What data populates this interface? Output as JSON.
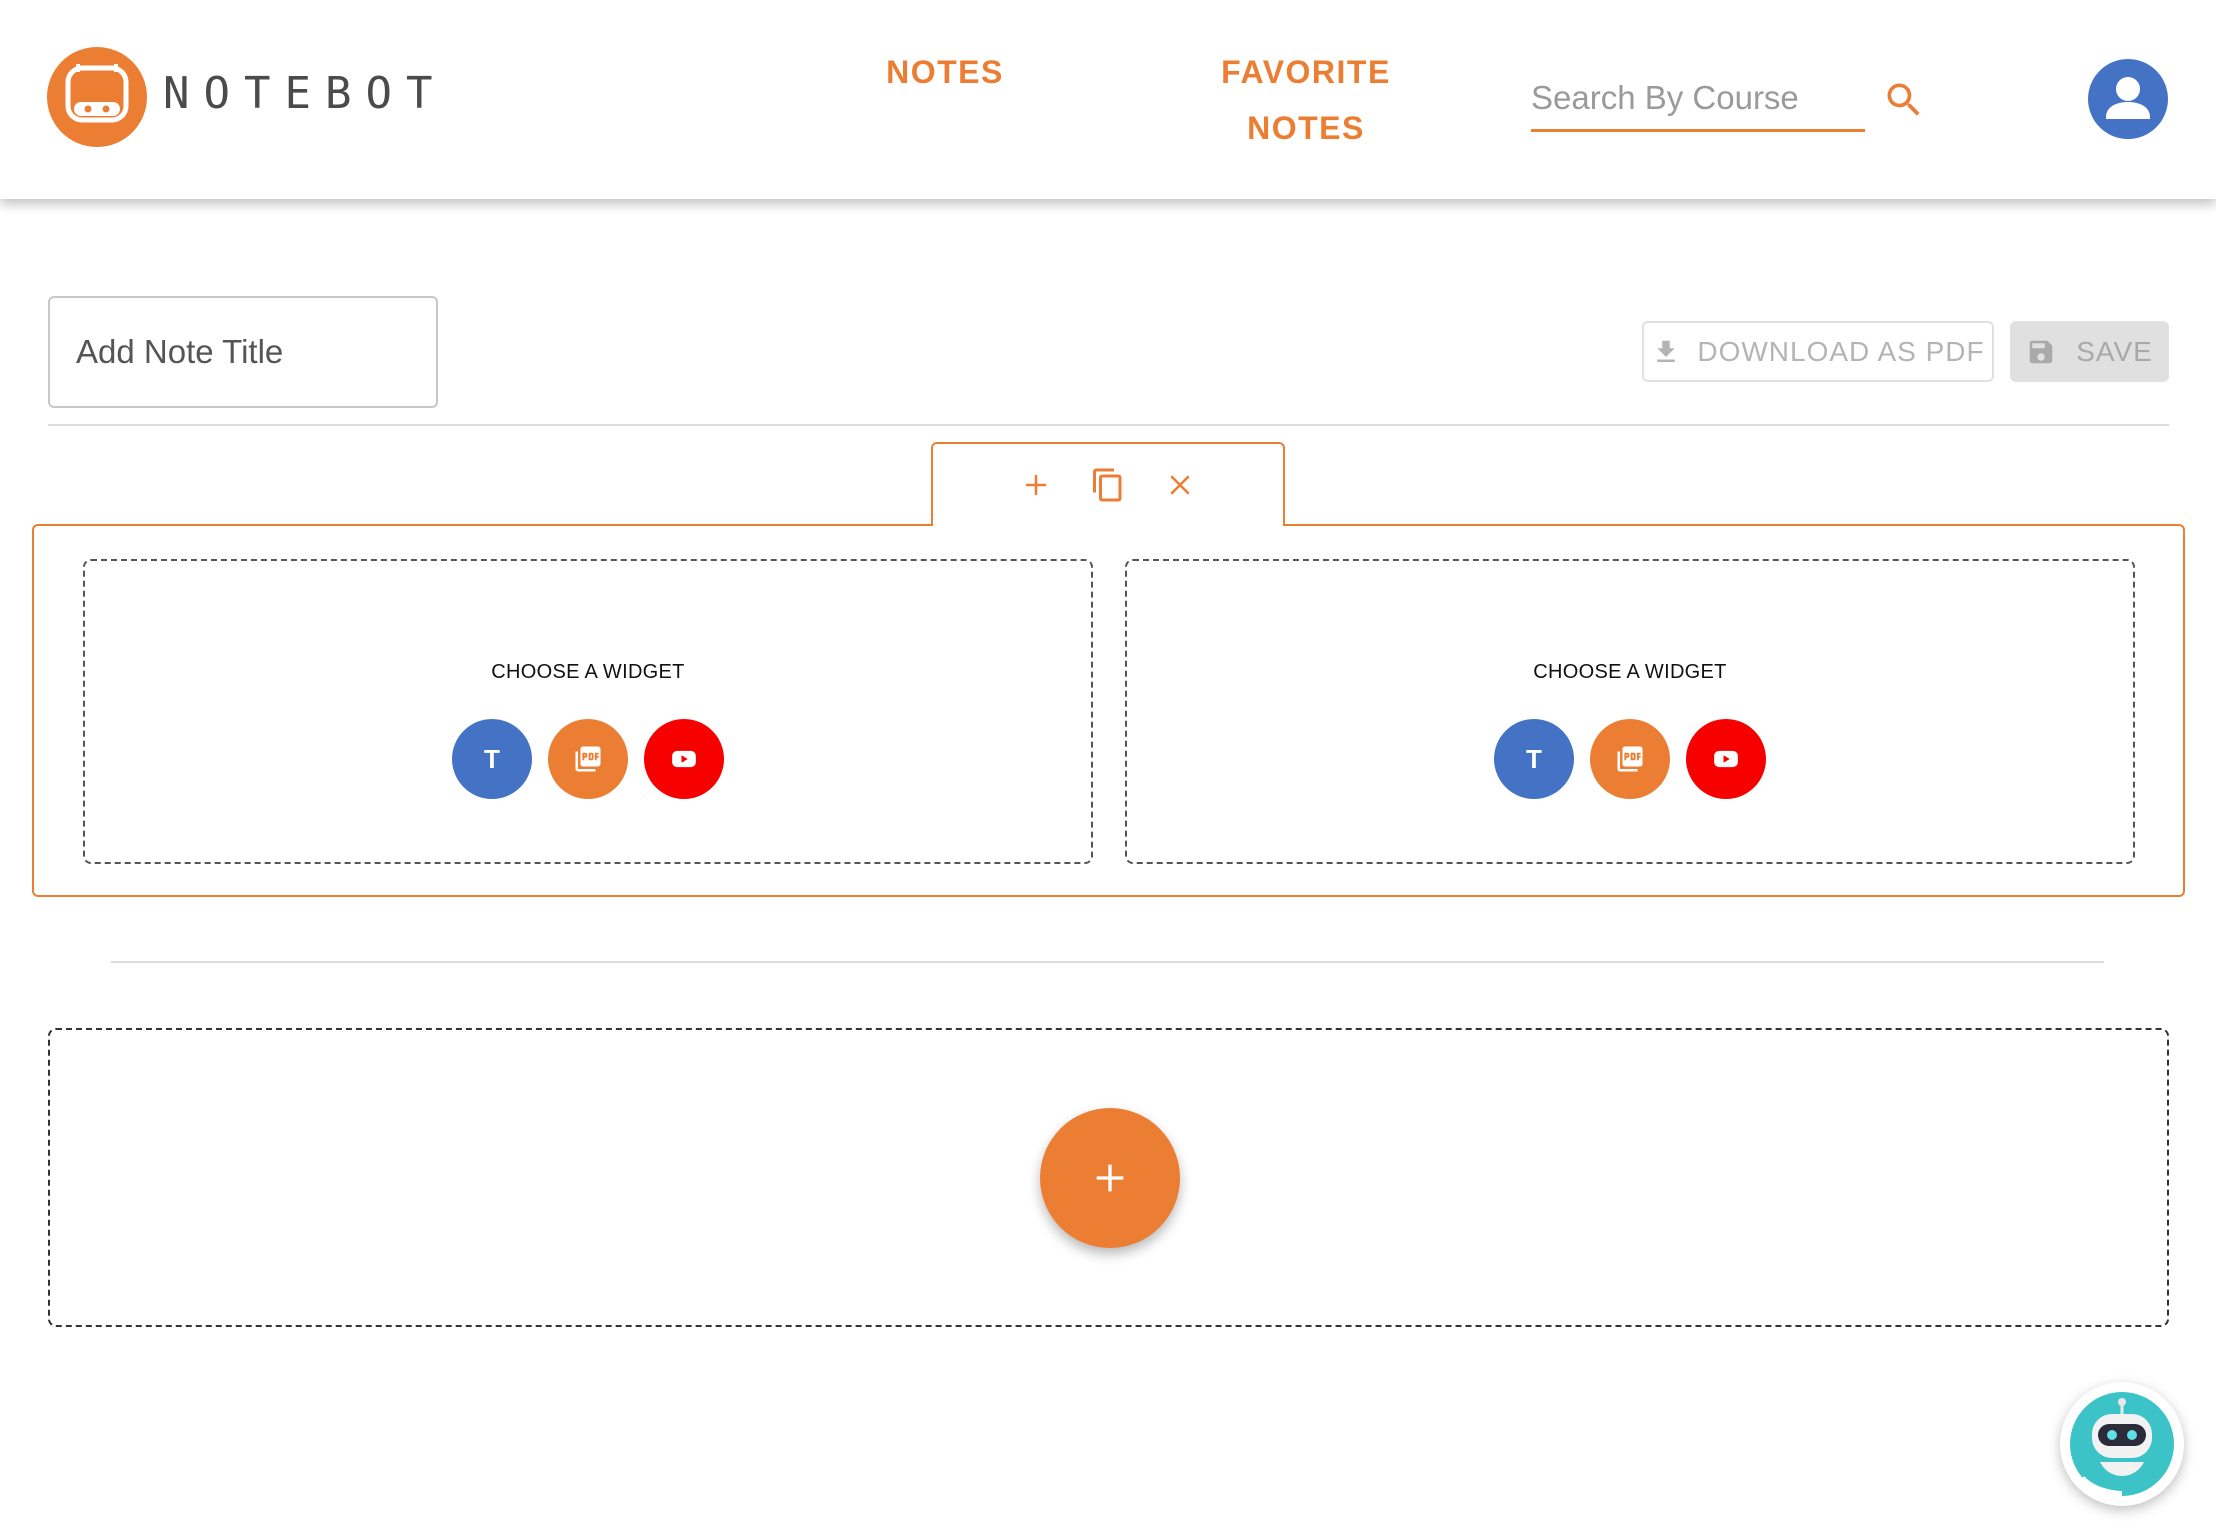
{
  "header": {
    "brand": "NOTEBOT",
    "nav": {
      "notes": "NOTES",
      "favorite_line1": "FAVORITE",
      "favorite_line2": "NOTES"
    },
    "search": {
      "placeholder": "Search By Course",
      "value": ""
    }
  },
  "editor": {
    "title_placeholder": "Add Note Title",
    "download_label": "DOWNLOAD AS PDF",
    "save_label": "SAVE",
    "row": {
      "slots": [
        {
          "label": "CHOOSE A WIDGET",
          "text_widget": "T"
        },
        {
          "label": "CHOOSE A WIDGET",
          "text_widget": "T"
        }
      ]
    }
  },
  "colors": {
    "accent": "#ec7e34",
    "blue": "#4472c4",
    "youtube_red": "#f60000",
    "chatbot_teal": "#3bc3c8"
  },
  "icons": [
    "logo-robot-icon",
    "search-icon",
    "user-icon",
    "download-icon",
    "save-icon",
    "plus-icon",
    "copy-icon",
    "close-icon",
    "pdf-icon",
    "youtube-icon",
    "chatbot-icon"
  ]
}
